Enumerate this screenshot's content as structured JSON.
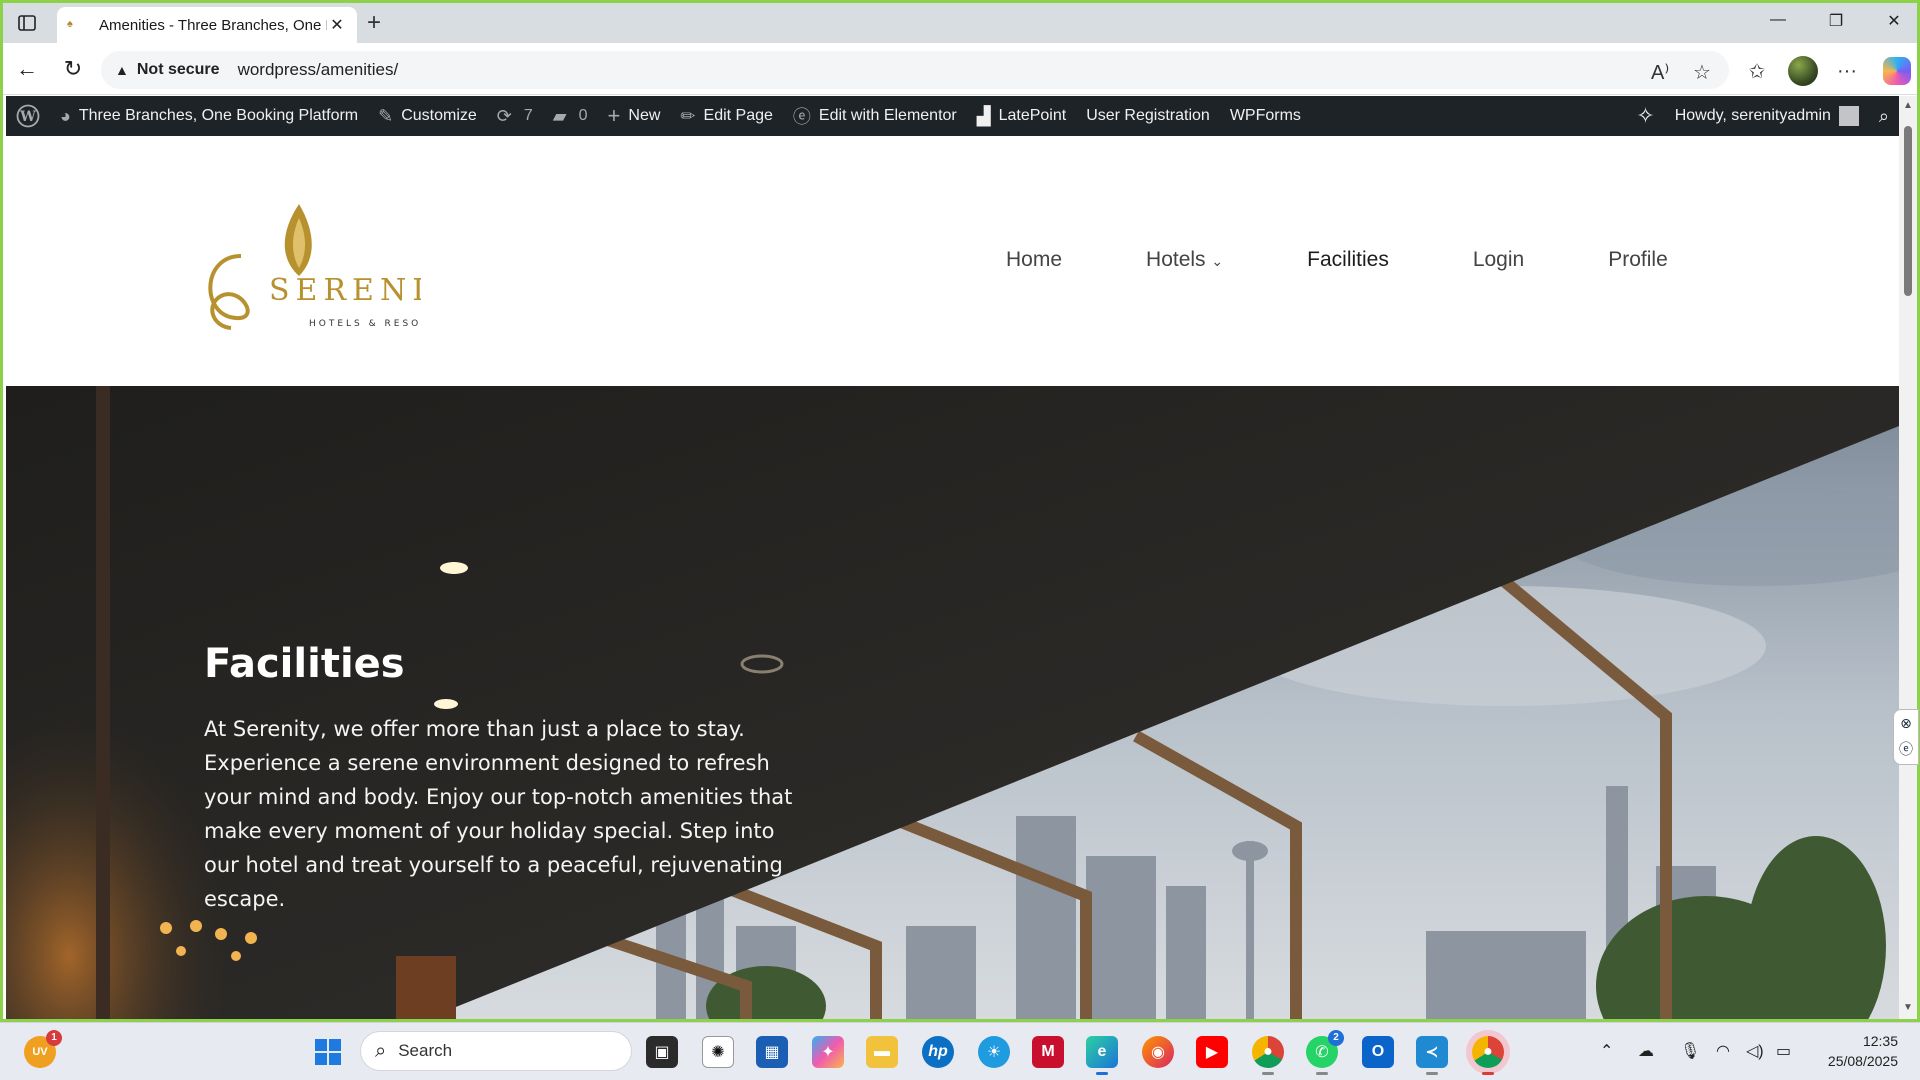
{
  "browser": {
    "tab_title": "Amenities - Three Branches, One Booking Platform",
    "new_tab_symbol": "+",
    "security_label": "Not secure",
    "url": "wordpress/amenities/"
  },
  "wp_admin_bar": {
    "site_name": "Three Branches, One Booking Platform",
    "customize": "Customize",
    "updates_count": "7",
    "comments_count": "0",
    "new": "New",
    "edit_page": "Edit Page",
    "edit_elementor": "Edit with Elementor",
    "latepoint": "LatePoint",
    "user_registration": "User Registration",
    "wpforms": "WPForms",
    "howdy": "Howdy, serenityadmin"
  },
  "site": {
    "logo_text": "SERENITY",
    "logo_subtext": "HOTELS & RESORTS",
    "nav": [
      {
        "label": "Home"
      },
      {
        "label": "Hotels"
      },
      {
        "label": "Facilities"
      },
      {
        "label": "Login"
      },
      {
        "label": "Profile"
      }
    ]
  },
  "hero": {
    "title": "Facilities",
    "text": "At Serenity, we offer more than just a place to stay. Experience a serene environment designed to refresh your mind and body. Enjoy our top-notch amenities that make every moment of your holiday special. Step into our hotel and treat yourself to a peaceful, rejuvenating escape."
  },
  "taskbar": {
    "weather_badge": "1",
    "weather_label": "UV",
    "search_placeholder": "Search",
    "whatsapp_badge": "2",
    "time": "12:35",
    "date": "25/08/2025"
  },
  "colors": {
    "accent_frame": "#8dd14a",
    "wp_bar": "#1d2327",
    "logo_gold": "#b8912f"
  }
}
